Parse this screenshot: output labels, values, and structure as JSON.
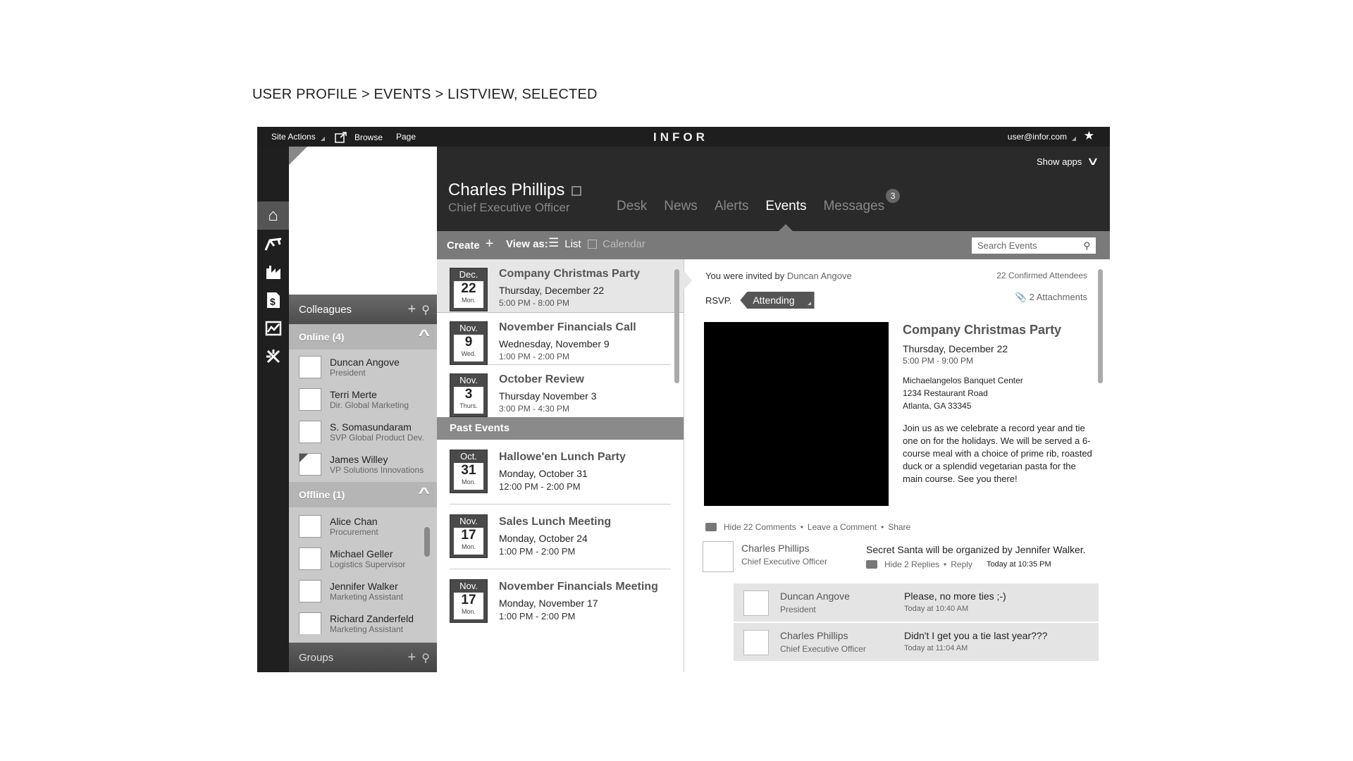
{
  "page_heading": "USER PROFILE > EVENTS > LISTVIEW, SELECTED",
  "topbar": {
    "site_actions": "Site Actions",
    "browse": "Browse",
    "page": "Page",
    "logo": "INFOR",
    "user_email": "user@infor.com"
  },
  "header": {
    "show_apps": "Show apps",
    "name": "Charles Phillips",
    "title": "Chief Executive Officer",
    "tabs": [
      {
        "label": "Desk"
      },
      {
        "label": "News"
      },
      {
        "label": "Alerts"
      },
      {
        "label": "Events"
      },
      {
        "label": "Messages",
        "badge": "3"
      }
    ]
  },
  "toolbar": {
    "create": "Create",
    "view_as": "View as:",
    "list": "List",
    "calendar": "Calendar",
    "search_placeholder": "Search Events"
  },
  "colleagues": {
    "title": "Colleagues",
    "online_label": "Online (4)",
    "online": [
      {
        "name": "Duncan Angove",
        "role": "President"
      },
      {
        "name": "Terri Merte",
        "role": "Dir. Global Marketing"
      },
      {
        "name": "S. Somasundaram",
        "role": "SVP Global Product Dev."
      },
      {
        "name": "James Willey",
        "role": "VP Solutions Innovations"
      }
    ],
    "offline_label": "Offline (1)",
    "offline": [
      {
        "name": "Alice Chan",
        "role": "Procurement"
      },
      {
        "name": "Michael Geller",
        "role": "Logistics Supervisor"
      },
      {
        "name": "Jennifer Walker",
        "role": "Marketing Assistant"
      },
      {
        "name": "Richard Zanderfeld",
        "role": "Marketing Assistant"
      }
    ],
    "groups_label": "Groups"
  },
  "events": {
    "upcoming": [
      {
        "month": "Dec.",
        "day": "22",
        "weekday": "Mon.",
        "title": "Company Christmas Party",
        "date": "Thursday, December 22",
        "time": "5:00 PM - 8:00 PM"
      },
      {
        "month": "Nov.",
        "day": "9",
        "weekday": "Wed.",
        "title": "November Financials Call",
        "date": "Wednesday, November 9",
        "time": "1:00 PM - 2:00 PM"
      },
      {
        "month": "Nov.",
        "day": "3",
        "weekday": "Thurs.",
        "title": "October Review",
        "date": "Thursday November 3",
        "time": "3:00 PM - 4:30 PM"
      }
    ],
    "past_label": "Past Events",
    "past": [
      {
        "month": "Oct.",
        "day": "31",
        "weekday": "Mon.",
        "title": "Hallowe'en Lunch Party",
        "date": "Monday, October 31",
        "time": "12:00 PM - 2:00 PM"
      },
      {
        "month": "Nov.",
        "day": "17",
        "weekday": "Mon.",
        "title": "Sales Lunch Meeting",
        "date": "Monday, October 24",
        "time": "1:00 PM - 2:00 PM"
      },
      {
        "month": "Nov.",
        "day": "17",
        "weekday": "Mon.",
        "title": "November Financials Meeting",
        "date": "Monday, November 17",
        "time": "1:00 PM - 2:00 PM"
      }
    ]
  },
  "detail": {
    "invited_prefix": "You were invited by",
    "invited_by": "Duncan Angove",
    "confirmed": "22 Confirmed Attendees",
    "rsvp_label": "RSVP.",
    "rsvp_value": "Attending",
    "attachments": "2 Attachments",
    "title": "Company Christmas Party",
    "date": "Thursday, December 22",
    "time": "5:00 PM - 9:00 PM",
    "venue": "Michaelangelos Banquet Center",
    "street": "1234 Restaurant Road",
    "city": "Atlanta, GA 33345",
    "description": "Join us as we celebrate a record year and tie one on for the holidays. We will be served a 6-course meal with a choice of prime rib, roasted duck or a splendid vegetarian pasta for the main course. See you there!",
    "hide_comments": "Hide 22 Comments",
    "leave_comment": "Leave a Comment",
    "share": "Share",
    "comment": {
      "name": "Charles Phillips",
      "role": "Chief Executive Officer",
      "text": "Secret Santa will be organized by Jennifer Walker.",
      "hide_replies": "Hide 2 Replies",
      "reply": "Reply",
      "time": "Today at 10:35 PM"
    },
    "replies": [
      {
        "name": "Duncan Angove",
        "role": "President",
        "text": "Please, no more ties ;-)",
        "time": "Today at 10:40 AM"
      },
      {
        "name": "Charles Phillips",
        "role": "Chief Executive Officer",
        "text": "Didn't I get you a tie last year???",
        "time": "Today at 11:04 AM"
      }
    ]
  }
}
